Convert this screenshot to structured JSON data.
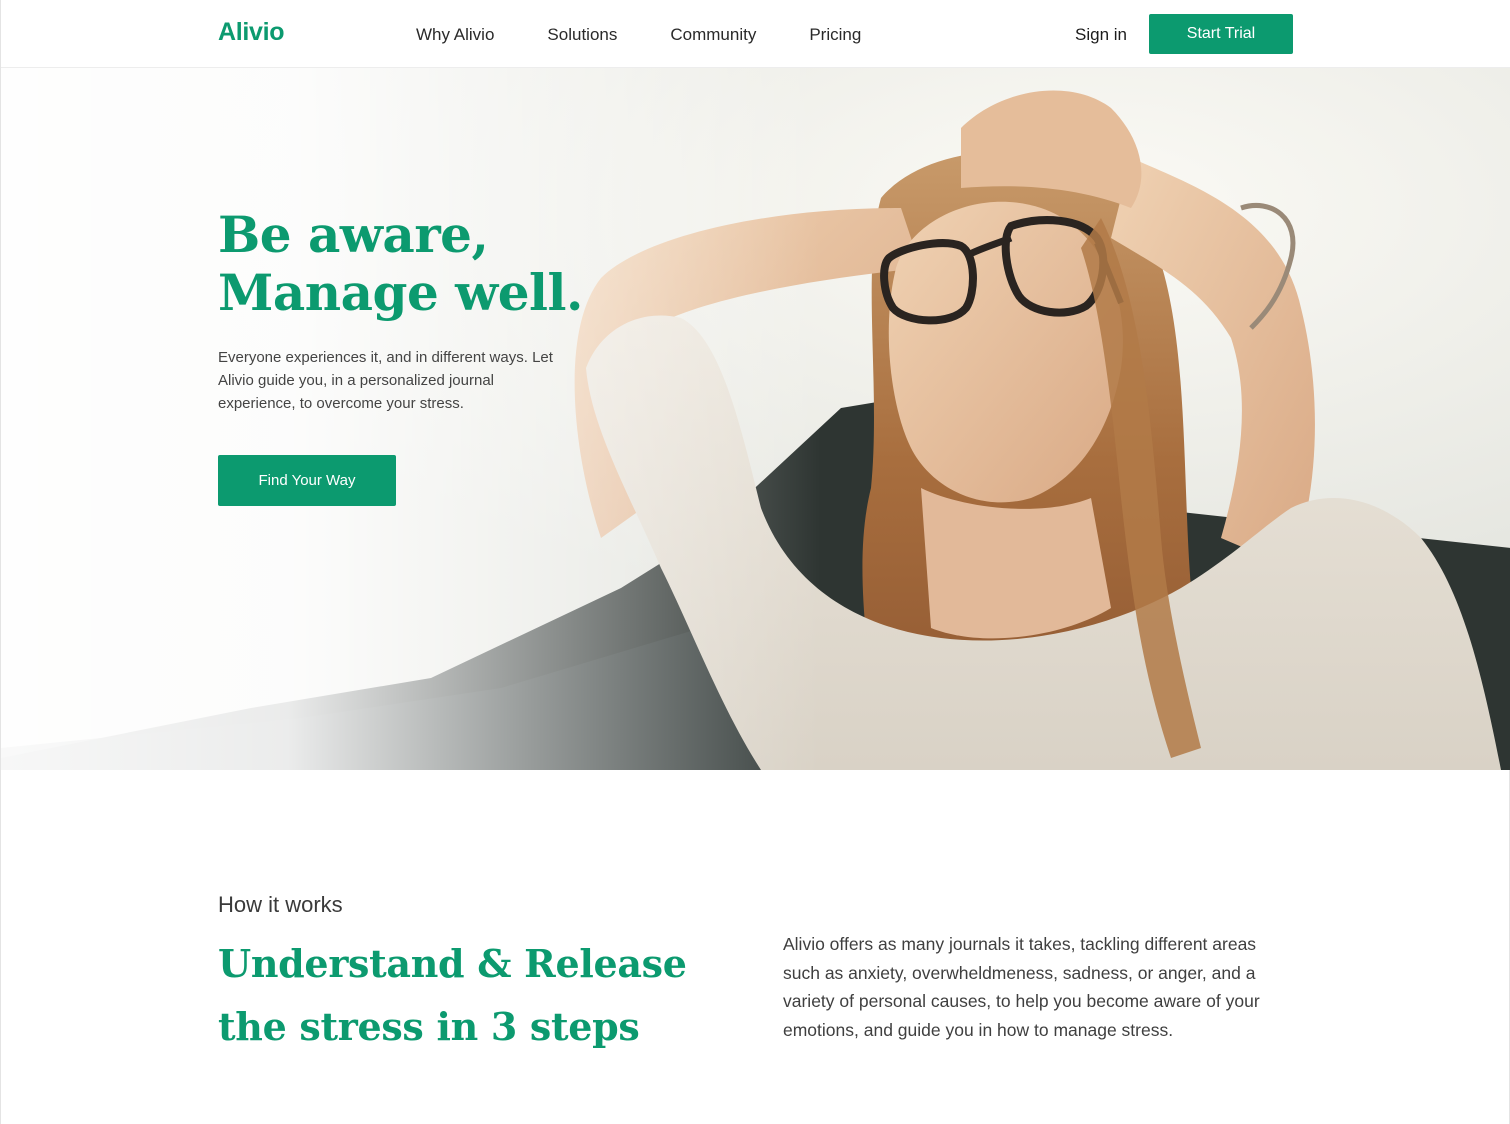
{
  "brand": {
    "name": "Alivio",
    "accent": "#0c9a6f"
  },
  "nav": {
    "items": [
      {
        "label": "Why Alivio"
      },
      {
        "label": "Solutions"
      },
      {
        "label": "Community"
      },
      {
        "label": "Pricing"
      }
    ],
    "sign_in": "Sign in",
    "start_trial": "Start Trial"
  },
  "hero": {
    "title_line1": "Be aware,",
    "title_line2": "Manage well.",
    "description": "Everyone experiences it, and in different ways. Let Alivio guide you, in a personalized journal experience, to overcome your stress.",
    "cta": "Find Your Way"
  },
  "how": {
    "label": "How it works",
    "title_line1": "Understand & Release",
    "title_line2": "the stress in 3 steps",
    "description": "Alivio offers as many journals it takes, tackling different areas such as anxiety, overwheldmeness, sadness, or anger, and a variety of personal causes, to help you become aware of your emotions, and guide you in how to manage stress."
  }
}
